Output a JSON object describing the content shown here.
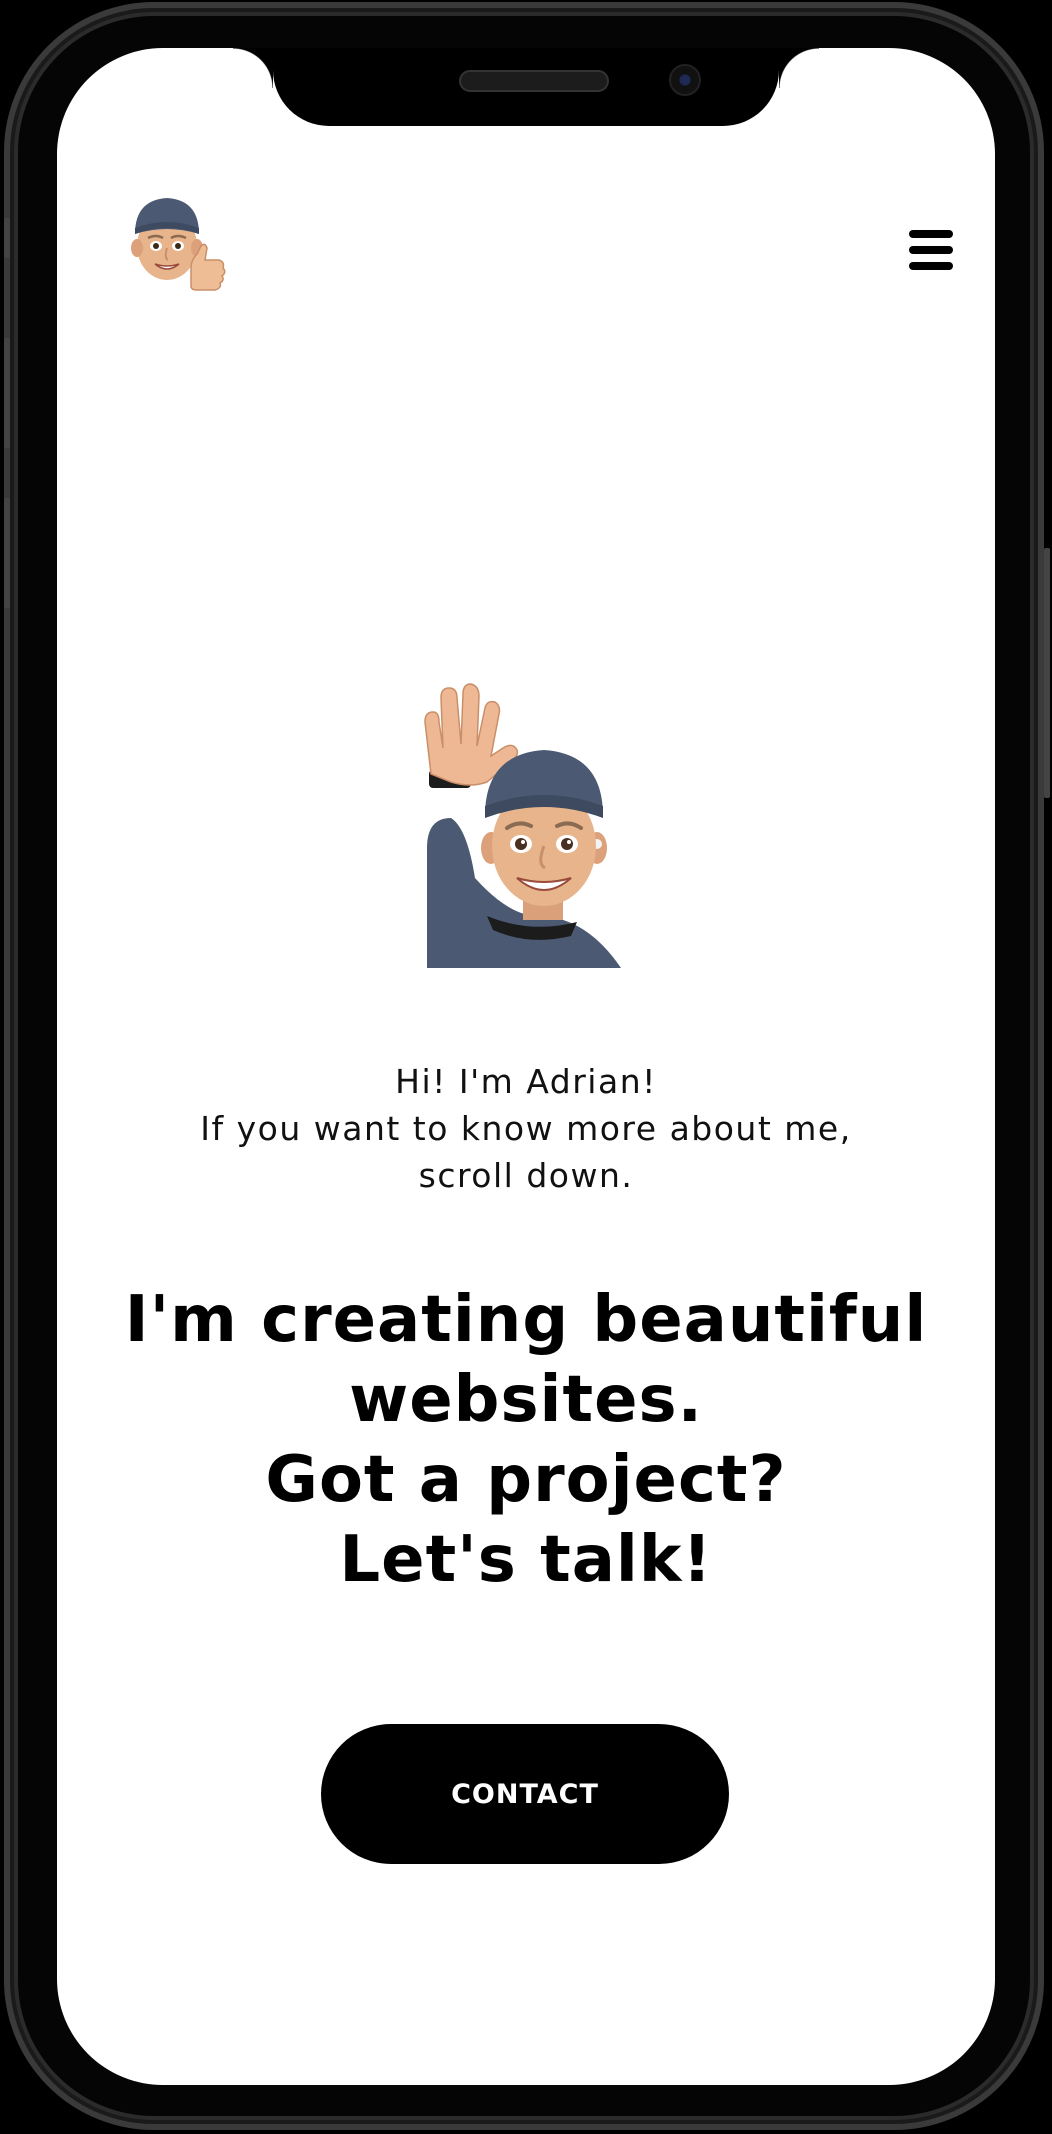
{
  "header": {
    "logo_icon": "memoji-thumbs-up-icon",
    "menu_icon": "hamburger-menu-icon"
  },
  "hero": {
    "image_icon": "memoji-waving-icon",
    "greeting": "Hi! I'm Adrian!",
    "scroll_hint": "If you want to know more about me, scroll down.",
    "headline_line1": "I'm creating beautiful websites.",
    "headline_line2": "Got a project? Let's talk!"
  },
  "cta": {
    "contact_label": "CONTACT"
  },
  "colors": {
    "background": "#ffffff",
    "text": "#000000",
    "button_bg": "#000000",
    "button_text": "#ffffff",
    "hat": "#4b5a72",
    "skin": "#e8b48c"
  }
}
